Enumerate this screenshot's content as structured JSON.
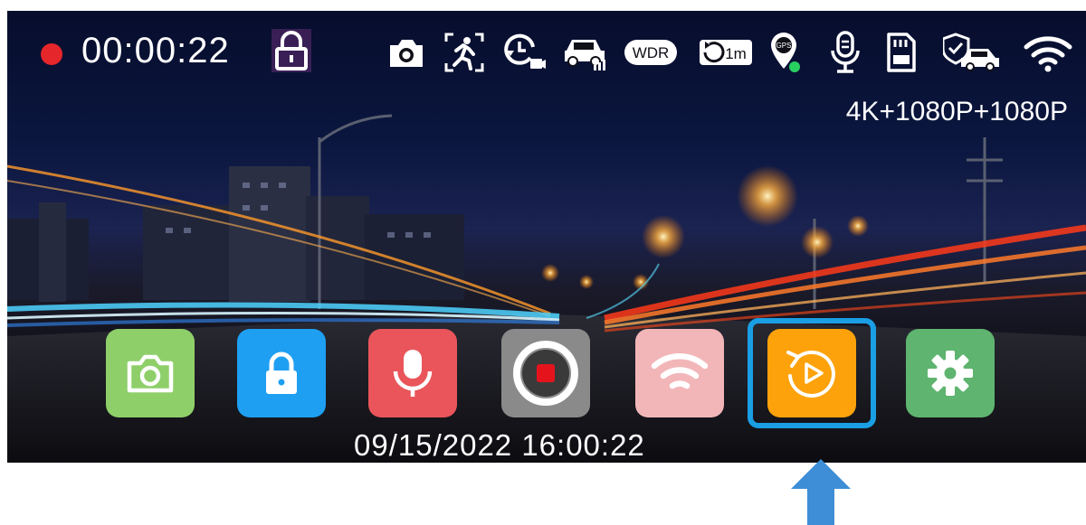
{
  "recording": {
    "time": "00:00:22",
    "colors": {
      "dot": "#e5262a",
      "lock_bg": "#5a2a6e"
    }
  },
  "status_icons": [
    {
      "name": "camera-icon"
    },
    {
      "name": "motion-detection-icon"
    },
    {
      "name": "timelapse-icon"
    },
    {
      "name": "parking-monitor-icon"
    },
    {
      "name": "wdr-icon",
      "label": "WDR"
    },
    {
      "name": "loop-recording-icon",
      "label": "1m"
    },
    {
      "name": "gps-icon",
      "label": "GPS"
    },
    {
      "name": "microphone-icon"
    },
    {
      "name": "sd-card-icon"
    },
    {
      "name": "collision-detection-icon"
    },
    {
      "name": "wifi-icon"
    }
  ],
  "resolution": "4K+1080P+1080P",
  "dock": {
    "buttons": [
      {
        "name": "snapshot-button",
        "icon": "camera-icon",
        "color": "#8fcf6a"
      },
      {
        "name": "lock-file-button",
        "icon": "lock-icon",
        "color": "#1e9ff2"
      },
      {
        "name": "microphone-button",
        "icon": "microphone-icon",
        "color": "#e9555a"
      },
      {
        "name": "record-button",
        "icon": "record-icon",
        "color": "#8a8a8a"
      },
      {
        "name": "wifi-button",
        "icon": "wifi-icon",
        "color": "#f2b6b8"
      },
      {
        "name": "playback-button",
        "icon": "playback-icon",
        "color": "#fda20b",
        "selected": true
      },
      {
        "name": "settings-button",
        "icon": "gear-icon",
        "color": "#5fb46f"
      }
    ],
    "focus_color": "#1a9ee4"
  },
  "datetime": "09/15/2022 16:00:22",
  "pointer": {
    "icon": "arrow-up-icon",
    "color": "#3d8ed6"
  }
}
